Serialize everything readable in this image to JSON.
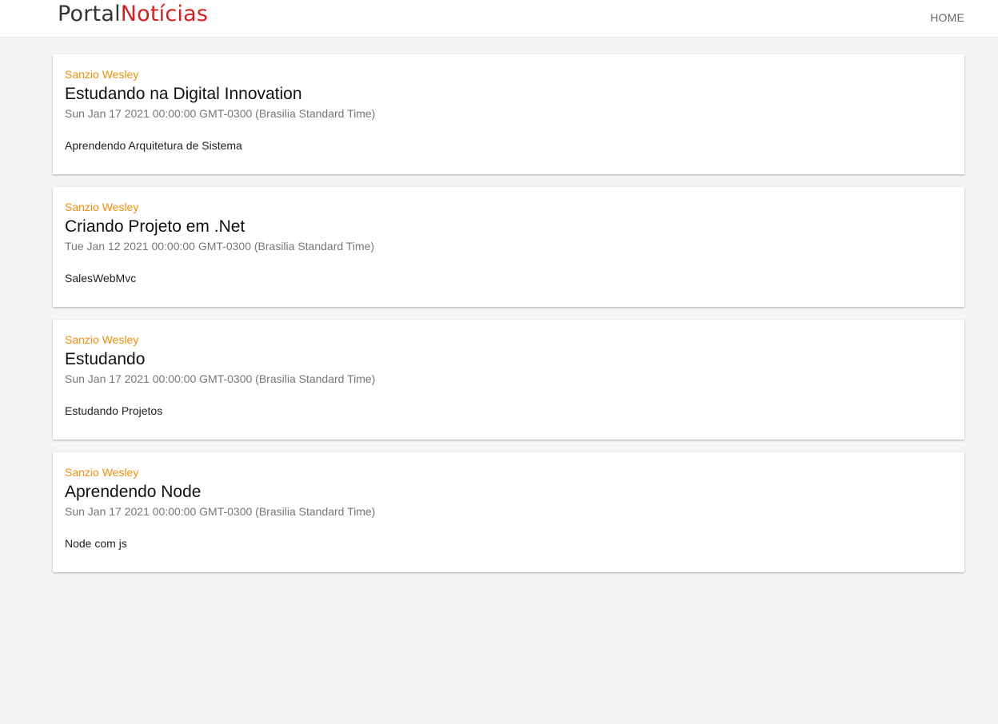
{
  "header": {
    "logo_part1": "Portal",
    "logo_part2": "Notícias",
    "nav_home": "HOME"
  },
  "posts": [
    {
      "author": "Sanzio Wesley",
      "title": "Estudando na Digital Innovation",
      "date": "Sun Jan 17 2021 00:00:00 GMT-0300 (Brasilia Standard Time)",
      "body": "Aprendendo Arquitetura de Sistema"
    },
    {
      "author": "Sanzio Wesley",
      "title": "Criando Projeto em .Net",
      "date": "Tue Jan 12 2021 00:00:00 GMT-0300 (Brasilia Standard Time)",
      "body": "SalesWebMvc"
    },
    {
      "author": "Sanzio Wesley",
      "title": "Estudando",
      "date": "Sun Jan 17 2021 00:00:00 GMT-0300 (Brasilia Standard Time)",
      "body": "Estudando Projetos"
    },
    {
      "author": "Sanzio Wesley",
      "title": "Aprendendo Node",
      "date": "Sun Jan 17 2021 00:00:00 GMT-0300 (Brasilia Standard Time)",
      "body": "Node com js"
    }
  ],
  "colors": {
    "logo_accent": "#d81e1e",
    "author": "#f0900a",
    "background": "#f5f5f5"
  }
}
